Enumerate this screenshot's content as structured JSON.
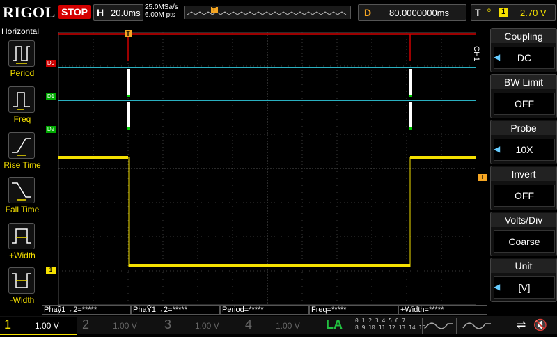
{
  "header": {
    "brand": "RIGOL",
    "run_state": "STOP",
    "horizontal_label": "H",
    "timebase": "20.0ms",
    "sample_rate": "25.0MSa/s",
    "memory_depth": "6.00M pts",
    "trigger_marker": "T",
    "delay_label": "D",
    "delay_value": "80.0000000ms",
    "trigger_label": "T",
    "trigger_source": "1",
    "trigger_level": "2.70 V"
  },
  "left_menu": {
    "title": "Horizontal",
    "items": [
      {
        "label": "Period"
      },
      {
        "label": "Freq"
      },
      {
        "label": "Rise Time"
      },
      {
        "label": "Fall Time"
      },
      {
        "label": "+Width"
      },
      {
        "label": "-Width"
      }
    ]
  },
  "right_menu": {
    "channel_tag": "CH1",
    "items": [
      {
        "title": "Coupling",
        "value": "DC"
      },
      {
        "title": "BW Limit",
        "value": "OFF"
      },
      {
        "title": "Probe",
        "value": "10X"
      },
      {
        "title": "Invert",
        "value": "OFF"
      },
      {
        "title": "Volts/Div",
        "value": "Coarse"
      },
      {
        "title": "Unit",
        "value": "[V]"
      }
    ]
  },
  "traces": {
    "d0_label": "D0",
    "d1_label": "D1",
    "d2_label": "D2",
    "ch1_marker": "1",
    "trigger_marker_right": "T"
  },
  "measurements": [
    {
      "label": "Phaŷ1→2=*****"
    },
    {
      "label": "PhaŶ1→2=*****"
    },
    {
      "label": "Period=*****"
    },
    {
      "label": "Freq=*****"
    },
    {
      "label": "+Width=*****"
    }
  ],
  "bottom": {
    "channels": [
      {
        "num": "1",
        "value": "1.00 V"
      },
      {
        "num": "2",
        "value": "1.00 V"
      },
      {
        "num": "3",
        "value": "1.00 V"
      },
      {
        "num": "4",
        "value": "1.00 V"
      }
    ],
    "la_label": "LA",
    "la_row1": "0 1 2 3   4 5 6 7",
    "la_row2": "8 9 10 11  12 13 14 15"
  },
  "colors": {
    "ch1": "#f5e000",
    "digital": "#2ab0c0",
    "trigger": "#f5a623",
    "red_line": "#d00000",
    "grid": "#3a3a3a"
  }
}
